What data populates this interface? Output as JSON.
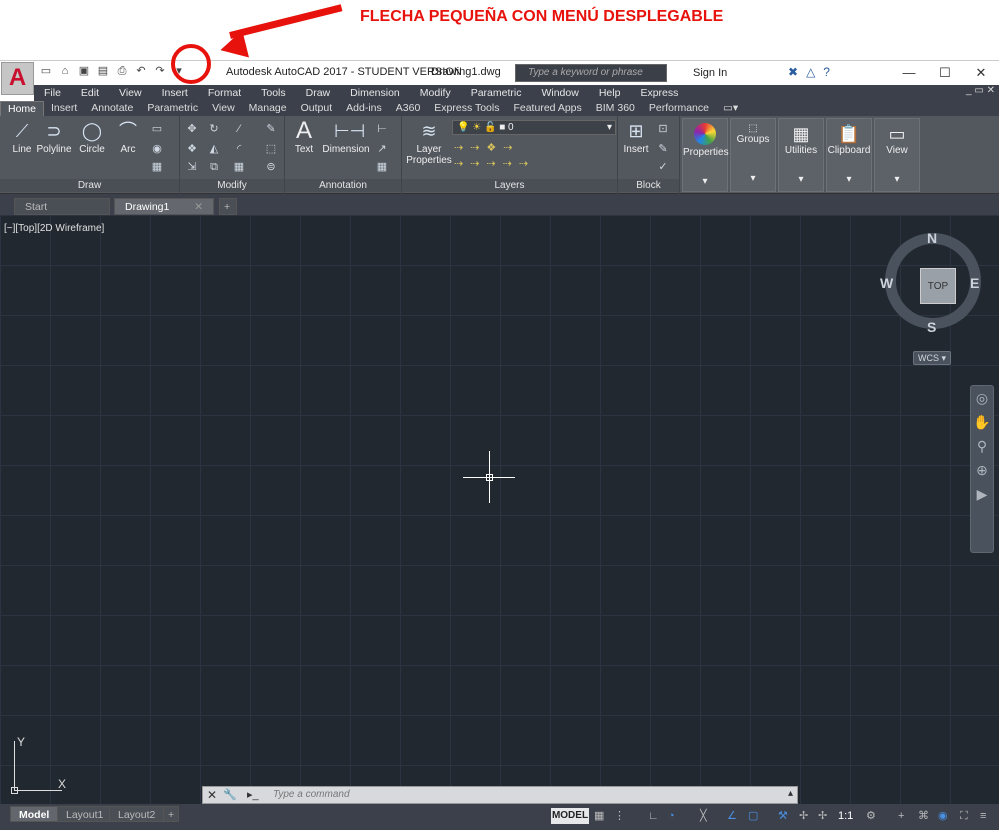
{
  "annotation": {
    "text": "FLECHA PEQUEÑA CON MENÚ DESPLEGABLE"
  },
  "titlebar": {
    "app_title": "Autodesk AutoCAD 2017 - STUDENT VERSION",
    "file_name": "Drawing1.dwg",
    "search_placeholder": "Type a keyword or phrase",
    "sign_in": "Sign In"
  },
  "menubar": [
    "File",
    "Edit",
    "View",
    "Insert",
    "Format",
    "Tools",
    "Draw",
    "Dimension",
    "Modify",
    "Parametric",
    "Window",
    "Help",
    "Express"
  ],
  "ribbon_tabs": [
    "Home",
    "Insert",
    "Annotate",
    "Parametric",
    "View",
    "Manage",
    "Output",
    "Add-ins",
    "A360",
    "Express Tools",
    "Featured Apps",
    "BIM 360",
    "Performance"
  ],
  "ribbon": {
    "draw": {
      "title": "Draw",
      "line": "Line",
      "polyline": "Polyline",
      "circle": "Circle",
      "arc": "Arc"
    },
    "modify": {
      "title": "Modify"
    },
    "annotation": {
      "title": "Annotation",
      "text": "Text",
      "dimension": "Dimension"
    },
    "layers": {
      "title": "Layers",
      "layer_props_1": "Layer",
      "layer_props_2": "Properties",
      "current_layer": "0"
    },
    "block": {
      "title": "Block",
      "insert": "Insert"
    },
    "properties": "Properties",
    "groups": "Groups",
    "utilities": "Utilities",
    "clipboard": "Clipboard",
    "view": "View"
  },
  "doc_tabs": {
    "start": "Start",
    "active": "Drawing1"
  },
  "viewport": {
    "label": "[−][Top][2D Wireframe]",
    "compass": {
      "n": "N",
      "s": "S",
      "e": "E",
      "w": "W",
      "top": "TOP"
    },
    "wcs": "WCS",
    "ucs_x": "X",
    "ucs_y": "Y"
  },
  "command": {
    "placeholder": "Type a command"
  },
  "layout_tabs": [
    "Model",
    "Layout1",
    "Layout2"
  ],
  "status": {
    "model": "MODEL",
    "scale": "1:1"
  }
}
